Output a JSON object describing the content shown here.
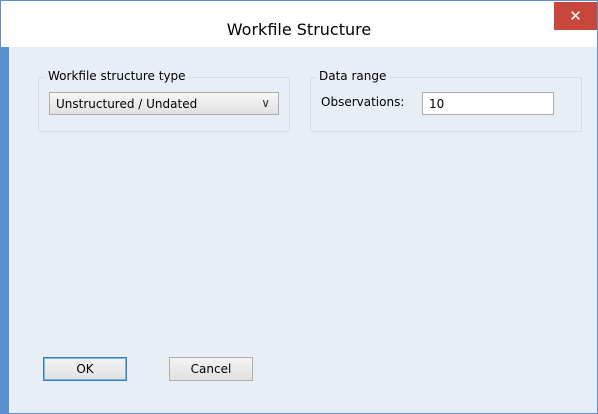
{
  "window": {
    "title": "Workfile Structure",
    "close_glyph": "✕"
  },
  "structure_group": {
    "legend": "Workfile structure type",
    "selected": "Unstructured / Undated",
    "arrow_glyph": "∨"
  },
  "range_group": {
    "legend": "Data range",
    "observations_label": "Observations:",
    "observations_value": "10"
  },
  "buttons": {
    "ok_label": "OK",
    "cancel_label": "Cancel"
  },
  "colors": {
    "title_bar_border": "#5a8fd0",
    "close_button": "#c7473d",
    "client_background": "#e8eef6"
  }
}
